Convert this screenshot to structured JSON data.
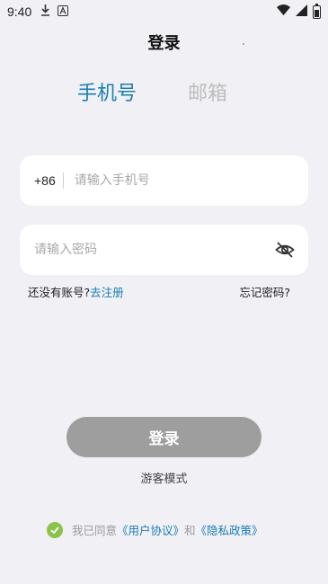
{
  "status_bar": {
    "time": "9:40",
    "icons": [
      "download-icon",
      "a-icon",
      "wifi-icon",
      "signal-icon",
      "battery-icon"
    ]
  },
  "page": {
    "title": "登录"
  },
  "tabs": [
    {
      "label": "手机号",
      "active": true
    },
    {
      "label": "邮箱",
      "active": false
    }
  ],
  "phone_input": {
    "prefix": "+86",
    "placeholder": "请输入手机号",
    "value": ""
  },
  "password_input": {
    "placeholder": "请输入密码",
    "value": "",
    "visibility_icon": "eye-off-icon"
  },
  "register": {
    "prompt": "还没有账号?",
    "link": "去注册"
  },
  "forgot_password": "忘记密码?",
  "login_button": "登录",
  "guest_mode": "游客模式",
  "agreement": {
    "checked": true,
    "prefix": "我已同意",
    "user_agreement": "《用户协议》",
    "and": "和",
    "privacy_policy": "《隐私政策》"
  },
  "colors": {
    "accent": "#1a7fb0",
    "background": "#f0f0f5",
    "button_disabled": "#9e9e9e",
    "check": "#8bc34a",
    "inactive_tab": "#bdbdbd"
  }
}
